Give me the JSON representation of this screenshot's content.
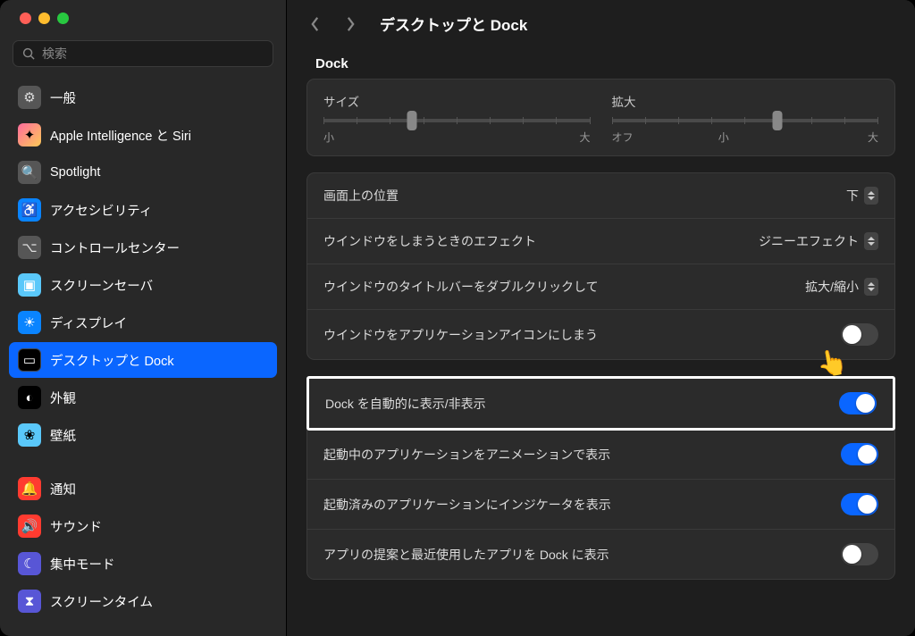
{
  "search": {
    "placeholder": "検索"
  },
  "sidebar": {
    "items": [
      {
        "label": "一般",
        "icon": "⚙",
        "cls": "i-gear"
      },
      {
        "label": "Apple Intelligence と Siri",
        "icon": "✦",
        "cls": "i-grad"
      },
      {
        "label": "Spotlight",
        "icon": "🔍",
        "cls": "i-spot"
      },
      {
        "label": "アクセシビリティ",
        "icon": "♿",
        "cls": "i-acc"
      },
      {
        "label": "コントロールセンター",
        "icon": "⌥",
        "cls": "i-cc"
      },
      {
        "label": "スクリーンセーバ",
        "icon": "▣",
        "cls": "i-ss"
      },
      {
        "label": "ディスプレイ",
        "icon": "☀",
        "cls": "i-disp"
      },
      {
        "label": "デスクトップと Dock",
        "icon": "▭",
        "cls": "i-dock",
        "active": true
      },
      {
        "label": "外観",
        "icon": "◐",
        "cls": "i-app"
      },
      {
        "label": "壁紙",
        "icon": "❀",
        "cls": "i-wall"
      },
      {
        "label": "通知",
        "icon": "🔔",
        "cls": "i-notif",
        "spacer": true
      },
      {
        "label": "サウンド",
        "icon": "🔊",
        "cls": "i-sound"
      },
      {
        "label": "集中モード",
        "icon": "☾",
        "cls": "i-focus"
      },
      {
        "label": "スクリーンタイム",
        "icon": "⧗",
        "cls": "i-time"
      }
    ]
  },
  "header": {
    "title": "デスクトップと Dock"
  },
  "dock": {
    "section": "Dock",
    "size": {
      "label": "サイズ",
      "min": "小",
      "max": "大",
      "value": 33
    },
    "mag": {
      "label": "拡大",
      "off": "オフ",
      "min": "小",
      "max": "大",
      "value": 62
    },
    "settings1": [
      {
        "label": "画面上の位置",
        "type": "select",
        "value": "下"
      },
      {
        "label": "ウインドウをしまうときのエフェクト",
        "type": "select",
        "value": "ジニーエフェクト"
      },
      {
        "label": "ウインドウのタイトルバーをダブルクリックして",
        "type": "select",
        "value": "拡大/縮小"
      },
      {
        "label": "ウインドウをアプリケーションアイコンにしまう",
        "type": "toggle",
        "on": false
      }
    ],
    "settings2": [
      {
        "label": "Dock を自動的に表示/非表示",
        "type": "toggle",
        "on": true,
        "highlight": true
      },
      {
        "label": "起動中のアプリケーションをアニメーションで表示",
        "type": "toggle",
        "on": true
      },
      {
        "label": "起動済みのアプリケーションにインジケータを表示",
        "type": "toggle",
        "on": true
      },
      {
        "label": "アプリの提案と最近使用したアプリを Dock に表示",
        "type": "toggle",
        "on": false
      }
    ]
  }
}
